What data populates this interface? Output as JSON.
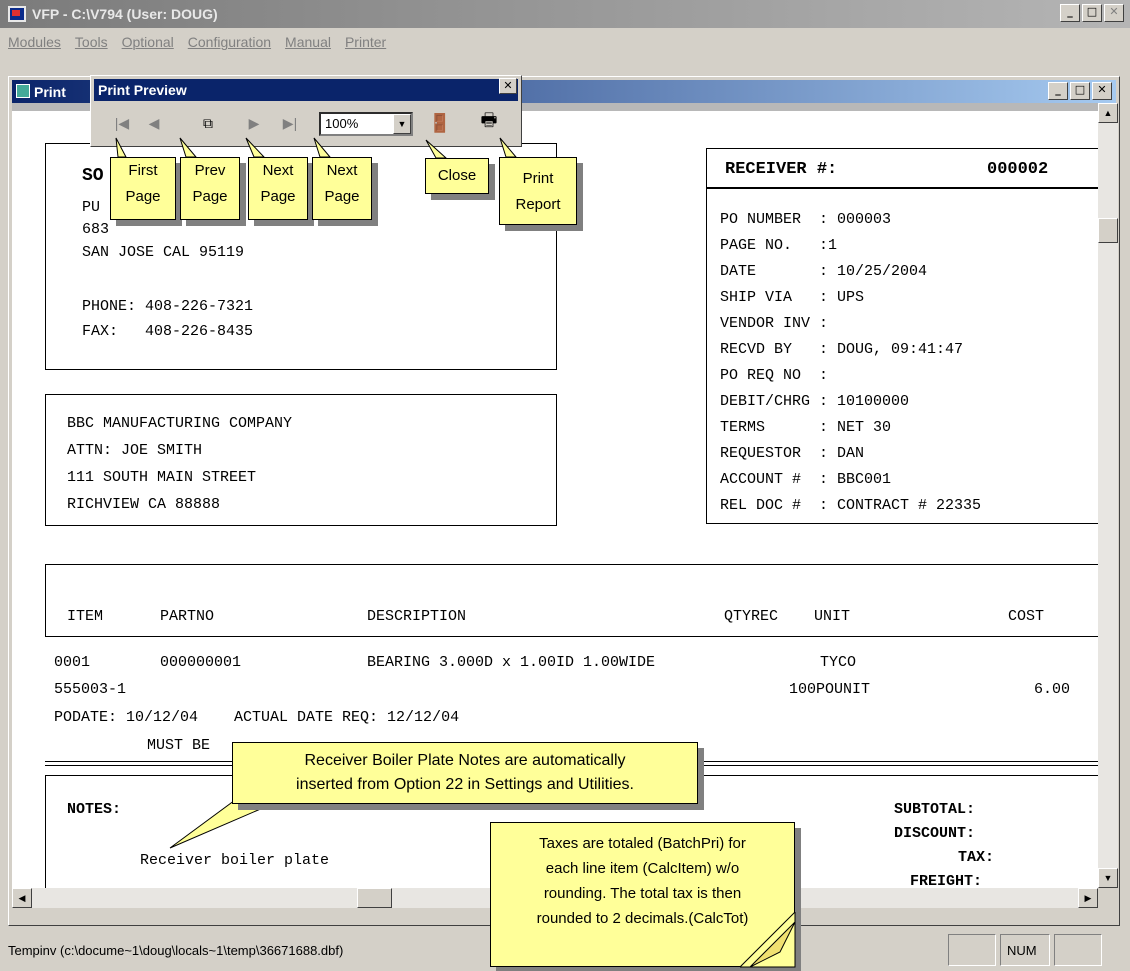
{
  "app": {
    "title": "VFP - C:\\V794  (User: DOUG)",
    "menu": [
      "Modules",
      "Tools",
      "Optional",
      "Configuration",
      "Manual",
      "Printer"
    ]
  },
  "child_window": {
    "title": "Print"
  },
  "print_preview": {
    "title": "Print Preview",
    "zoom": "100%",
    "close_glyph": "✕"
  },
  "callouts": {
    "first": [
      "First",
      "Page"
    ],
    "prev": [
      "Prev",
      "Page"
    ],
    "next1": [
      "Next",
      "Page"
    ],
    "next2": [
      "Next",
      "Page"
    ],
    "close": "Close",
    "print": [
      "Print",
      "Report"
    ],
    "boiler": [
      "Receiver Boiler Plate Notes are automatically",
      "inserted from Option 22 in Settings and Utilities."
    ],
    "taxes": [
      "Taxes are totaled (BatchPri) for",
      "each line item (CalcItem) w/o",
      "rounding.  The total tax is then",
      "rounded to 2 decimals.(CalcTot)"
    ]
  },
  "document": {
    "company_lines": [
      "SO",
      "PU",
      "683",
      "SAN JOSE CAL 95119",
      "",
      "PHONE: 408-226-7321",
      "FAX:   408-226-8435"
    ],
    "receiver_label": "RECEIVER #:",
    "receiver_no": "000002",
    "info_lines": [
      "PO NUMBER  : 000003",
      "PAGE NO.   :1",
      "DATE       : 10/25/2004",
      "SHIP VIA   : UPS",
      "VENDOR INV :",
      "RECVD BY   : DOUG, 09:41:47",
      "PO REQ NO  :",
      "DEBIT/CHRG : 10100000",
      "TERMS      : NET 30",
      "REQUESTOR  : DAN",
      "ACCOUNT #  : BBC001",
      "REL DOC #  : CONTRACT # 22335"
    ],
    "vendor_lines": [
      "BBC MANUFACTURING COMPANY",
      "ATTN: JOE SMITH",
      "111 SOUTH MAIN STREET",
      "RICHVIEW CA 88888"
    ],
    "columns": {
      "item": "ITEM",
      "partno": "PARTNO",
      "description": "DESCRIPTION",
      "qtyrec": "QTYREC",
      "unit": "UNIT",
      "cost": "COST"
    },
    "row1": {
      "item": "0001",
      "partno": "000000001",
      "description": "BEARING 3.000D x 1.00ID 1.00WIDE",
      "unit": "TYCO"
    },
    "row2": {
      "part": "555003-1",
      "qty_unit": "100POUNIT",
      "cost": "6.00"
    },
    "row3": "PODATE: 10/12/04    ACTUAL DATE REQ: 12/12/04",
    "row4": "MUST BE",
    "notes_label": "NOTES:",
    "boiler_text": "Receiver boiler plate",
    "totals": [
      "SUBTOTAL:",
      "DISCOUNT:",
      "TAX:",
      "FREIGHT:"
    ]
  },
  "status": {
    "path": "Tempinv (c:\\docume~1\\doug\\locals~1\\temp\\36671688.dbf)",
    "num": "NUM"
  }
}
